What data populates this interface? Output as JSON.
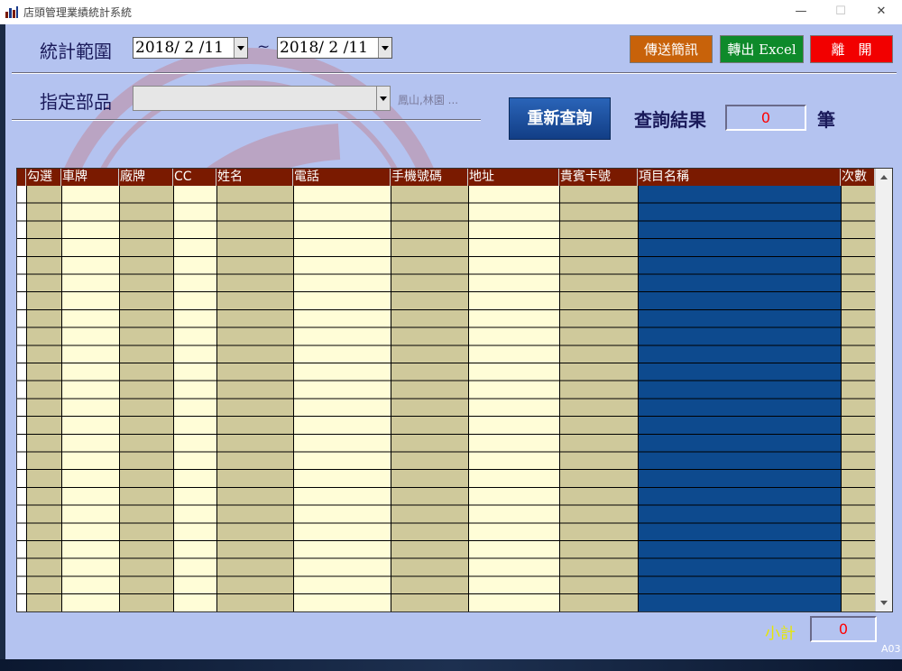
{
  "window": {
    "title": "店頭管理業績統計系統",
    "minimize": "—",
    "maximize": "☐",
    "close": "✕"
  },
  "filter": {
    "range_label": "統計範圍",
    "start_date": "2018/ 2 /11",
    "separator": "~",
    "end_date": "2018/ 2 /11",
    "part_label": "指定部品",
    "part_value": "",
    "part_hint": "鳳山,林園 ..."
  },
  "buttons": {
    "sms": "傳送簡訊",
    "excel": "轉出 Excel",
    "exit": "離　開",
    "requery": "重新查詢"
  },
  "result": {
    "label": "查詢結果",
    "count": "0",
    "unit": "筆"
  },
  "table": {
    "columns": [
      "勾選",
      "車牌",
      "廠牌",
      "CC",
      "姓名",
      "電話",
      "手機號碼",
      "地址",
      "貴賓卡號",
      "項目名稱",
      "次數"
    ],
    "rows": []
  },
  "footer": {
    "subtotal_label": "小計",
    "subtotal_value": "0",
    "form_code": "A03"
  },
  "colors": {
    "header": "#7a1a00",
    "khaki": "#cfc99b",
    "cream": "#fffdd7",
    "navy": "#0d4a8e",
    "client_bg": "#b4c3f0"
  }
}
